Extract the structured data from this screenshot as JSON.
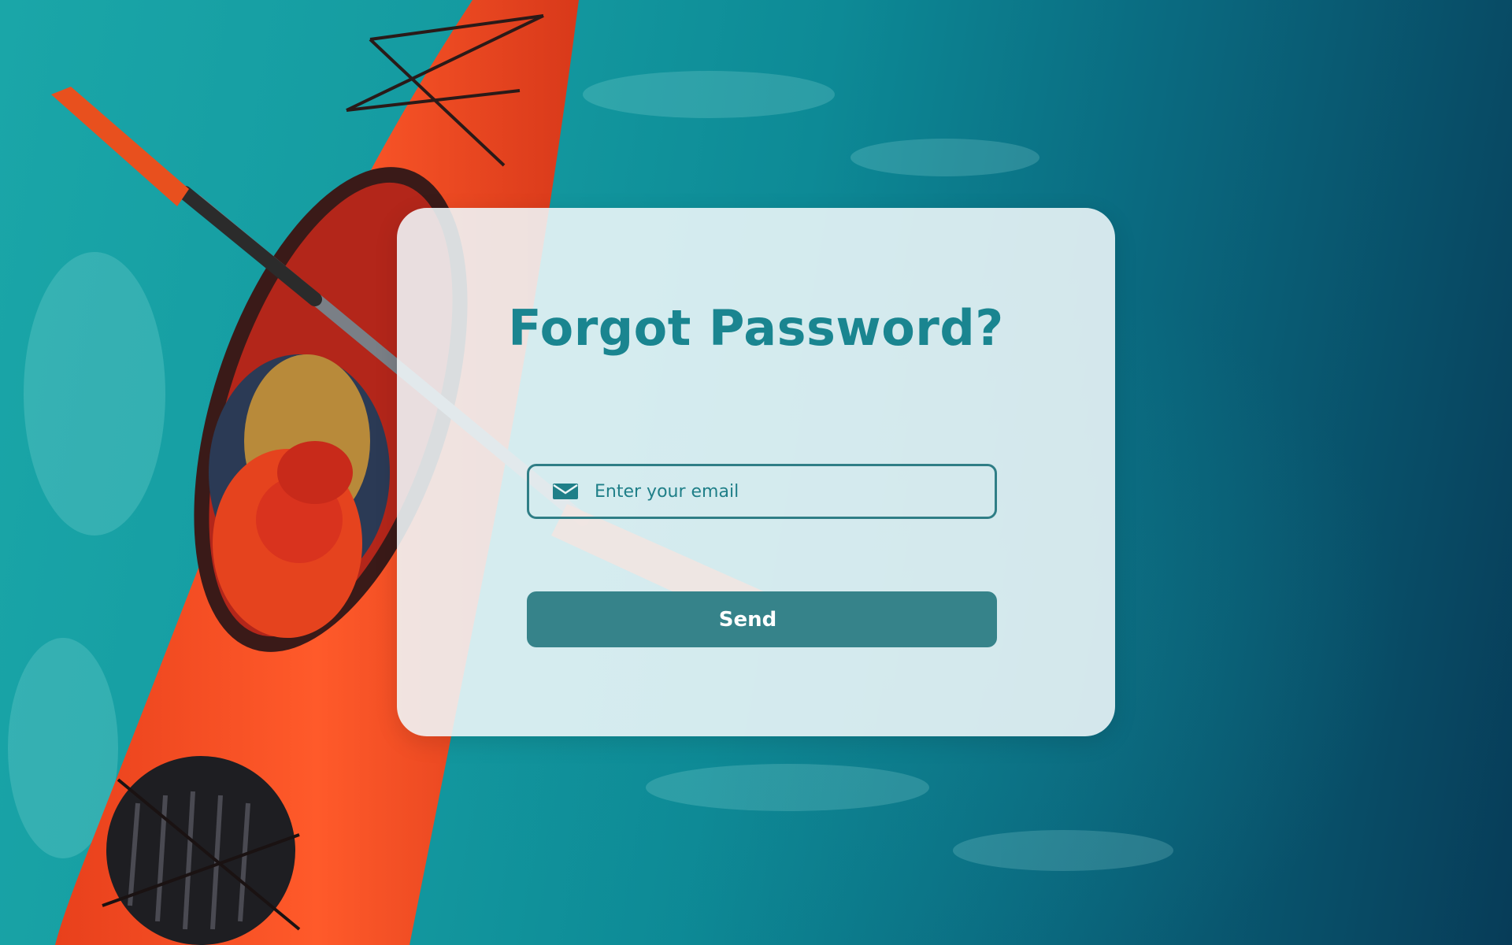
{
  "page": {
    "title": "Forgot Password?"
  },
  "form": {
    "email_placeholder": "Enter your email",
    "email_value": "",
    "send_label": "Send"
  },
  "icons": {
    "email": "mail-icon"
  },
  "colors": {
    "accent": "#1a8590",
    "button_bg": "#36838a",
    "button_text": "#ffffff",
    "card_bg": "#f0f8fa",
    "field_border": "#2f7e86"
  }
}
